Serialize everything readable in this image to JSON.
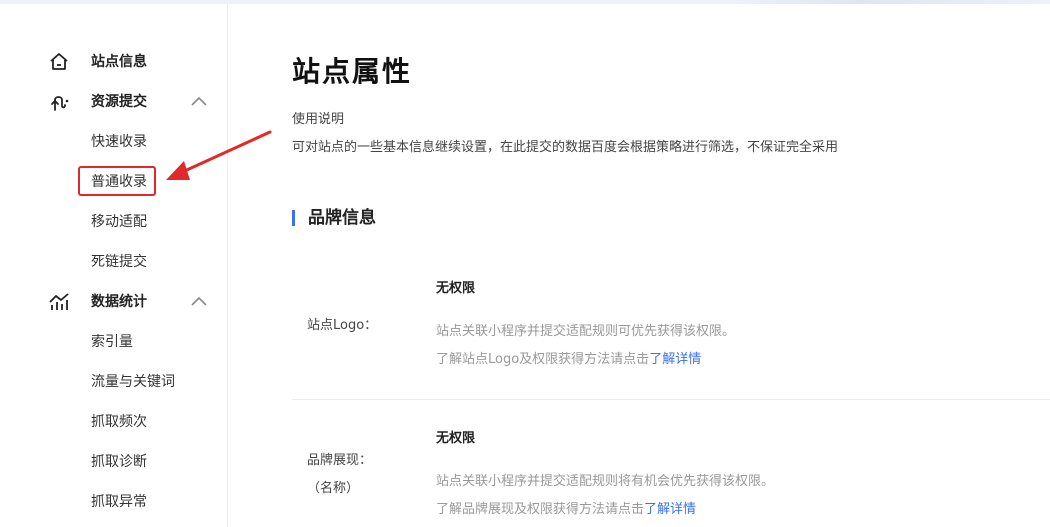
{
  "sidebar": {
    "items": [
      {
        "type": "group",
        "label": "站点信息",
        "icon": "home-icon"
      },
      {
        "type": "group",
        "label": "资源提交",
        "icon": "resource-submit-icon",
        "expanded": true
      },
      {
        "type": "sub",
        "label": "快速收录"
      },
      {
        "type": "sub",
        "label": "普通收录",
        "highlighted": true
      },
      {
        "type": "sub",
        "label": "移动适配"
      },
      {
        "type": "sub",
        "label": "死链提交"
      },
      {
        "type": "group",
        "label": "数据统计",
        "icon": "stats-icon",
        "expanded": true
      },
      {
        "type": "sub",
        "label": "索引量"
      },
      {
        "type": "sub",
        "label": "流量与关键词"
      },
      {
        "type": "sub",
        "label": "抓取频次"
      },
      {
        "type": "sub",
        "label": "抓取诊断"
      },
      {
        "type": "sub",
        "label": "抓取异常"
      }
    ]
  },
  "main": {
    "title": "站点属性",
    "usage_title": "使用说明",
    "usage_desc": "可对站点的一些基本信息继续设置，在此提交的数据百度会根据策略进行筛选，不保证完全采用",
    "section_title": "品牌信息",
    "rows": [
      {
        "label": "站点Logo：",
        "status": "无权限",
        "hint": "站点关联小程序并提交适配规则可优先获得该权限。",
        "link_prefix": "了解站点Logo及权限获得方法请点击",
        "link_text": "了解详情"
      },
      {
        "label": "品牌展现：",
        "label2": "（名称）",
        "status": "无权限",
        "hint": "站点关联小程序并提交适配规则将有机会优先获得该权限。",
        "link_prefix": "了解品牌展现及权限获得方法请点击",
        "link_text": "了解详情"
      }
    ]
  },
  "colors": {
    "accent": "#3a71f2",
    "annotation_red": "#e3282a"
  }
}
